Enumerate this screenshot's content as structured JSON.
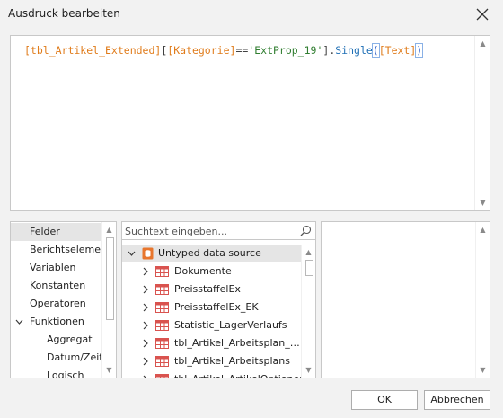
{
  "window": {
    "title": "Ausdruck bearbeiten"
  },
  "expression": {
    "t1": "[tbl_Artikel_Extended]",
    "t2": "[",
    "t3": "[Kategorie]",
    "t4": "==",
    "t5": "'ExtProp_19'",
    "t6": "].",
    "t7": "Single",
    "t8": "(",
    "t9": "[Text]",
    "t10": ")"
  },
  "categories": {
    "items": [
      {
        "label": "Felder",
        "selected": true
      },
      {
        "label": "Berichtselemente"
      },
      {
        "label": "Variablen"
      },
      {
        "label": "Konstanten"
      },
      {
        "label": "Operatoren"
      },
      {
        "label": "Funktionen",
        "expanded": true
      },
      {
        "label": "Aggregat",
        "child": true
      },
      {
        "label": "Datum/Zeit",
        "child": true
      },
      {
        "label": "Logisch",
        "child": true
      }
    ]
  },
  "search": {
    "placeholder": "Suchtext eingeben..."
  },
  "tree": {
    "root": "Untyped data source",
    "items": [
      "Dokumente",
      "PreisstaffelEx",
      "PreisstaffelEx_EK",
      "Statistic_LagerVerlaufs",
      "tbl_Artikel_Arbeitsplan_Beilagen",
      "tbl_Artikel_Arbeitsplans",
      "tbl_Artikel_ArtikelOptionen"
    ]
  },
  "buttons": {
    "ok": "OK",
    "cancel": "Abbrechen"
  },
  "colors": {
    "field": "#e07b1a",
    "string": "#2f7d2f",
    "function": "#1f6fb5",
    "table_icon": "#d9534f",
    "datasource_icon": "#e8762d"
  }
}
